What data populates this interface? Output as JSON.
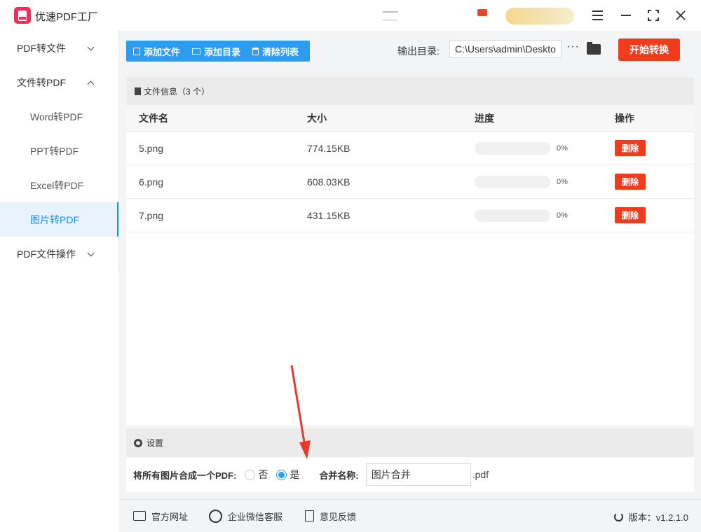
{
  "app": {
    "title": "优速PDF工厂"
  },
  "sidebar": {
    "items": [
      {
        "label": "PDF转文件",
        "chevron": "down"
      },
      {
        "label": "文件转PDF",
        "chevron": "up"
      },
      {
        "label": "Word转PDF",
        "sub": true
      },
      {
        "label": "PPT转PDF",
        "sub": true
      },
      {
        "label": "Excel转PDF",
        "sub": true
      },
      {
        "label": "图片转PDF",
        "sub": true,
        "active": true
      },
      {
        "label": "PDF文件操作",
        "chevron": "down"
      }
    ]
  },
  "toolbar": {
    "add_file": "添加文件",
    "add_dir": "添加目录",
    "clear_list": "清除列表",
    "output_label": "输出目录:",
    "output_path": "C:\\Users\\admin\\Deskto",
    "more": "···",
    "start": "开始转换"
  },
  "files": {
    "header": "文件信息（3 个）",
    "columns": [
      "文件名",
      "大小",
      "进度",
      "操作"
    ],
    "rows": [
      {
        "name": "5.png",
        "size": "774.15KB",
        "progress": 0,
        "progress_text": "0%",
        "action": "删除"
      },
      {
        "name": "6.png",
        "size": "608.03KB",
        "progress": 0,
        "progress_text": "0%",
        "action": "删除"
      },
      {
        "name": "7.png",
        "size": "431.15KB",
        "progress": 0,
        "progress_text": "0%",
        "action": "删除"
      }
    ]
  },
  "settings": {
    "header": "设置",
    "merge_label": "将所有图片合成一个PDF:",
    "opt_no": "否",
    "opt_yes": "是",
    "selected": "yes",
    "name_label": "合并名称:",
    "name_value": "图片合并",
    "suffix": ".pdf"
  },
  "footer": {
    "website": "官方网址",
    "wechat": "企业微信客服",
    "feedback": "意见反馈",
    "version": "版本：v1.2.1.0"
  },
  "colors": {
    "accent": "#2c9cf0",
    "danger": "#ee3c1c",
    "annotation_arrow": "#e8392d"
  },
  "icons": [
    "pdf-logo-icon",
    "menu-icon",
    "minimize-icon",
    "maximize-icon",
    "close-icon",
    "file-icon",
    "folder-icon",
    "trash-icon",
    "more-icon",
    "gear-icon",
    "website-icon",
    "wechat-icon",
    "feedback-icon",
    "refresh-icon"
  ]
}
